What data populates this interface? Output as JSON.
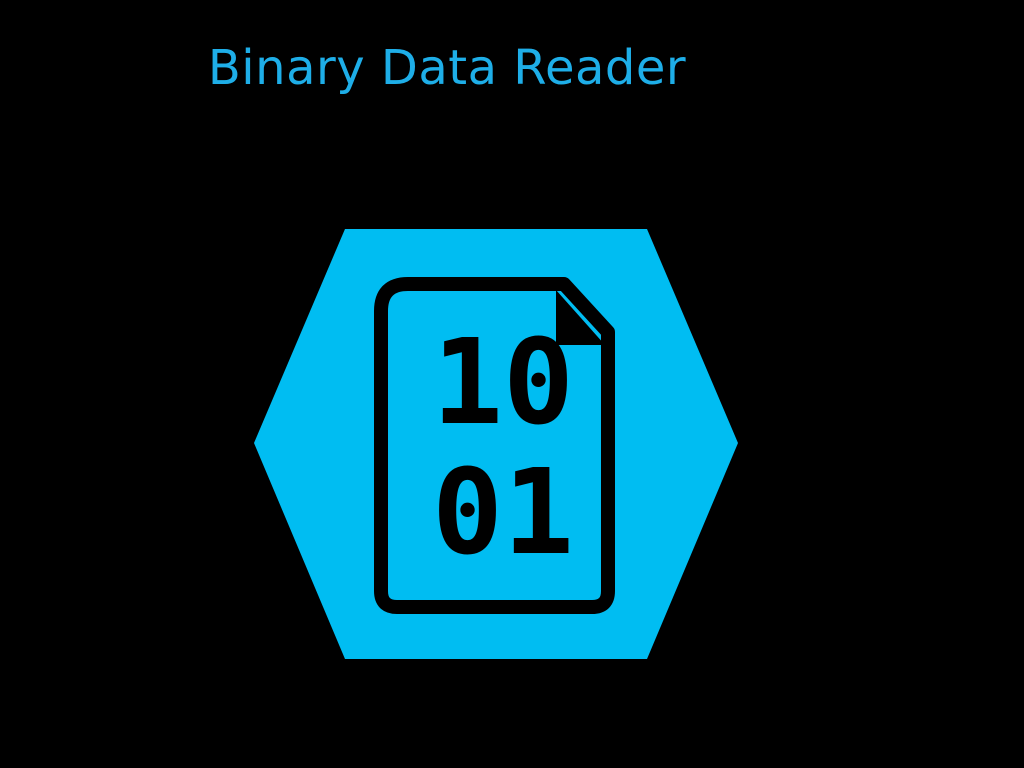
{
  "app": {
    "title": "Binary Data Reader"
  },
  "icon": {
    "name": "binary-file-icon",
    "line1": "10",
    "line2": "01"
  },
  "colors": {
    "background": "#000000",
    "accent": "#00bdf2",
    "title": "#1eaee8",
    "ink": "#000000"
  }
}
